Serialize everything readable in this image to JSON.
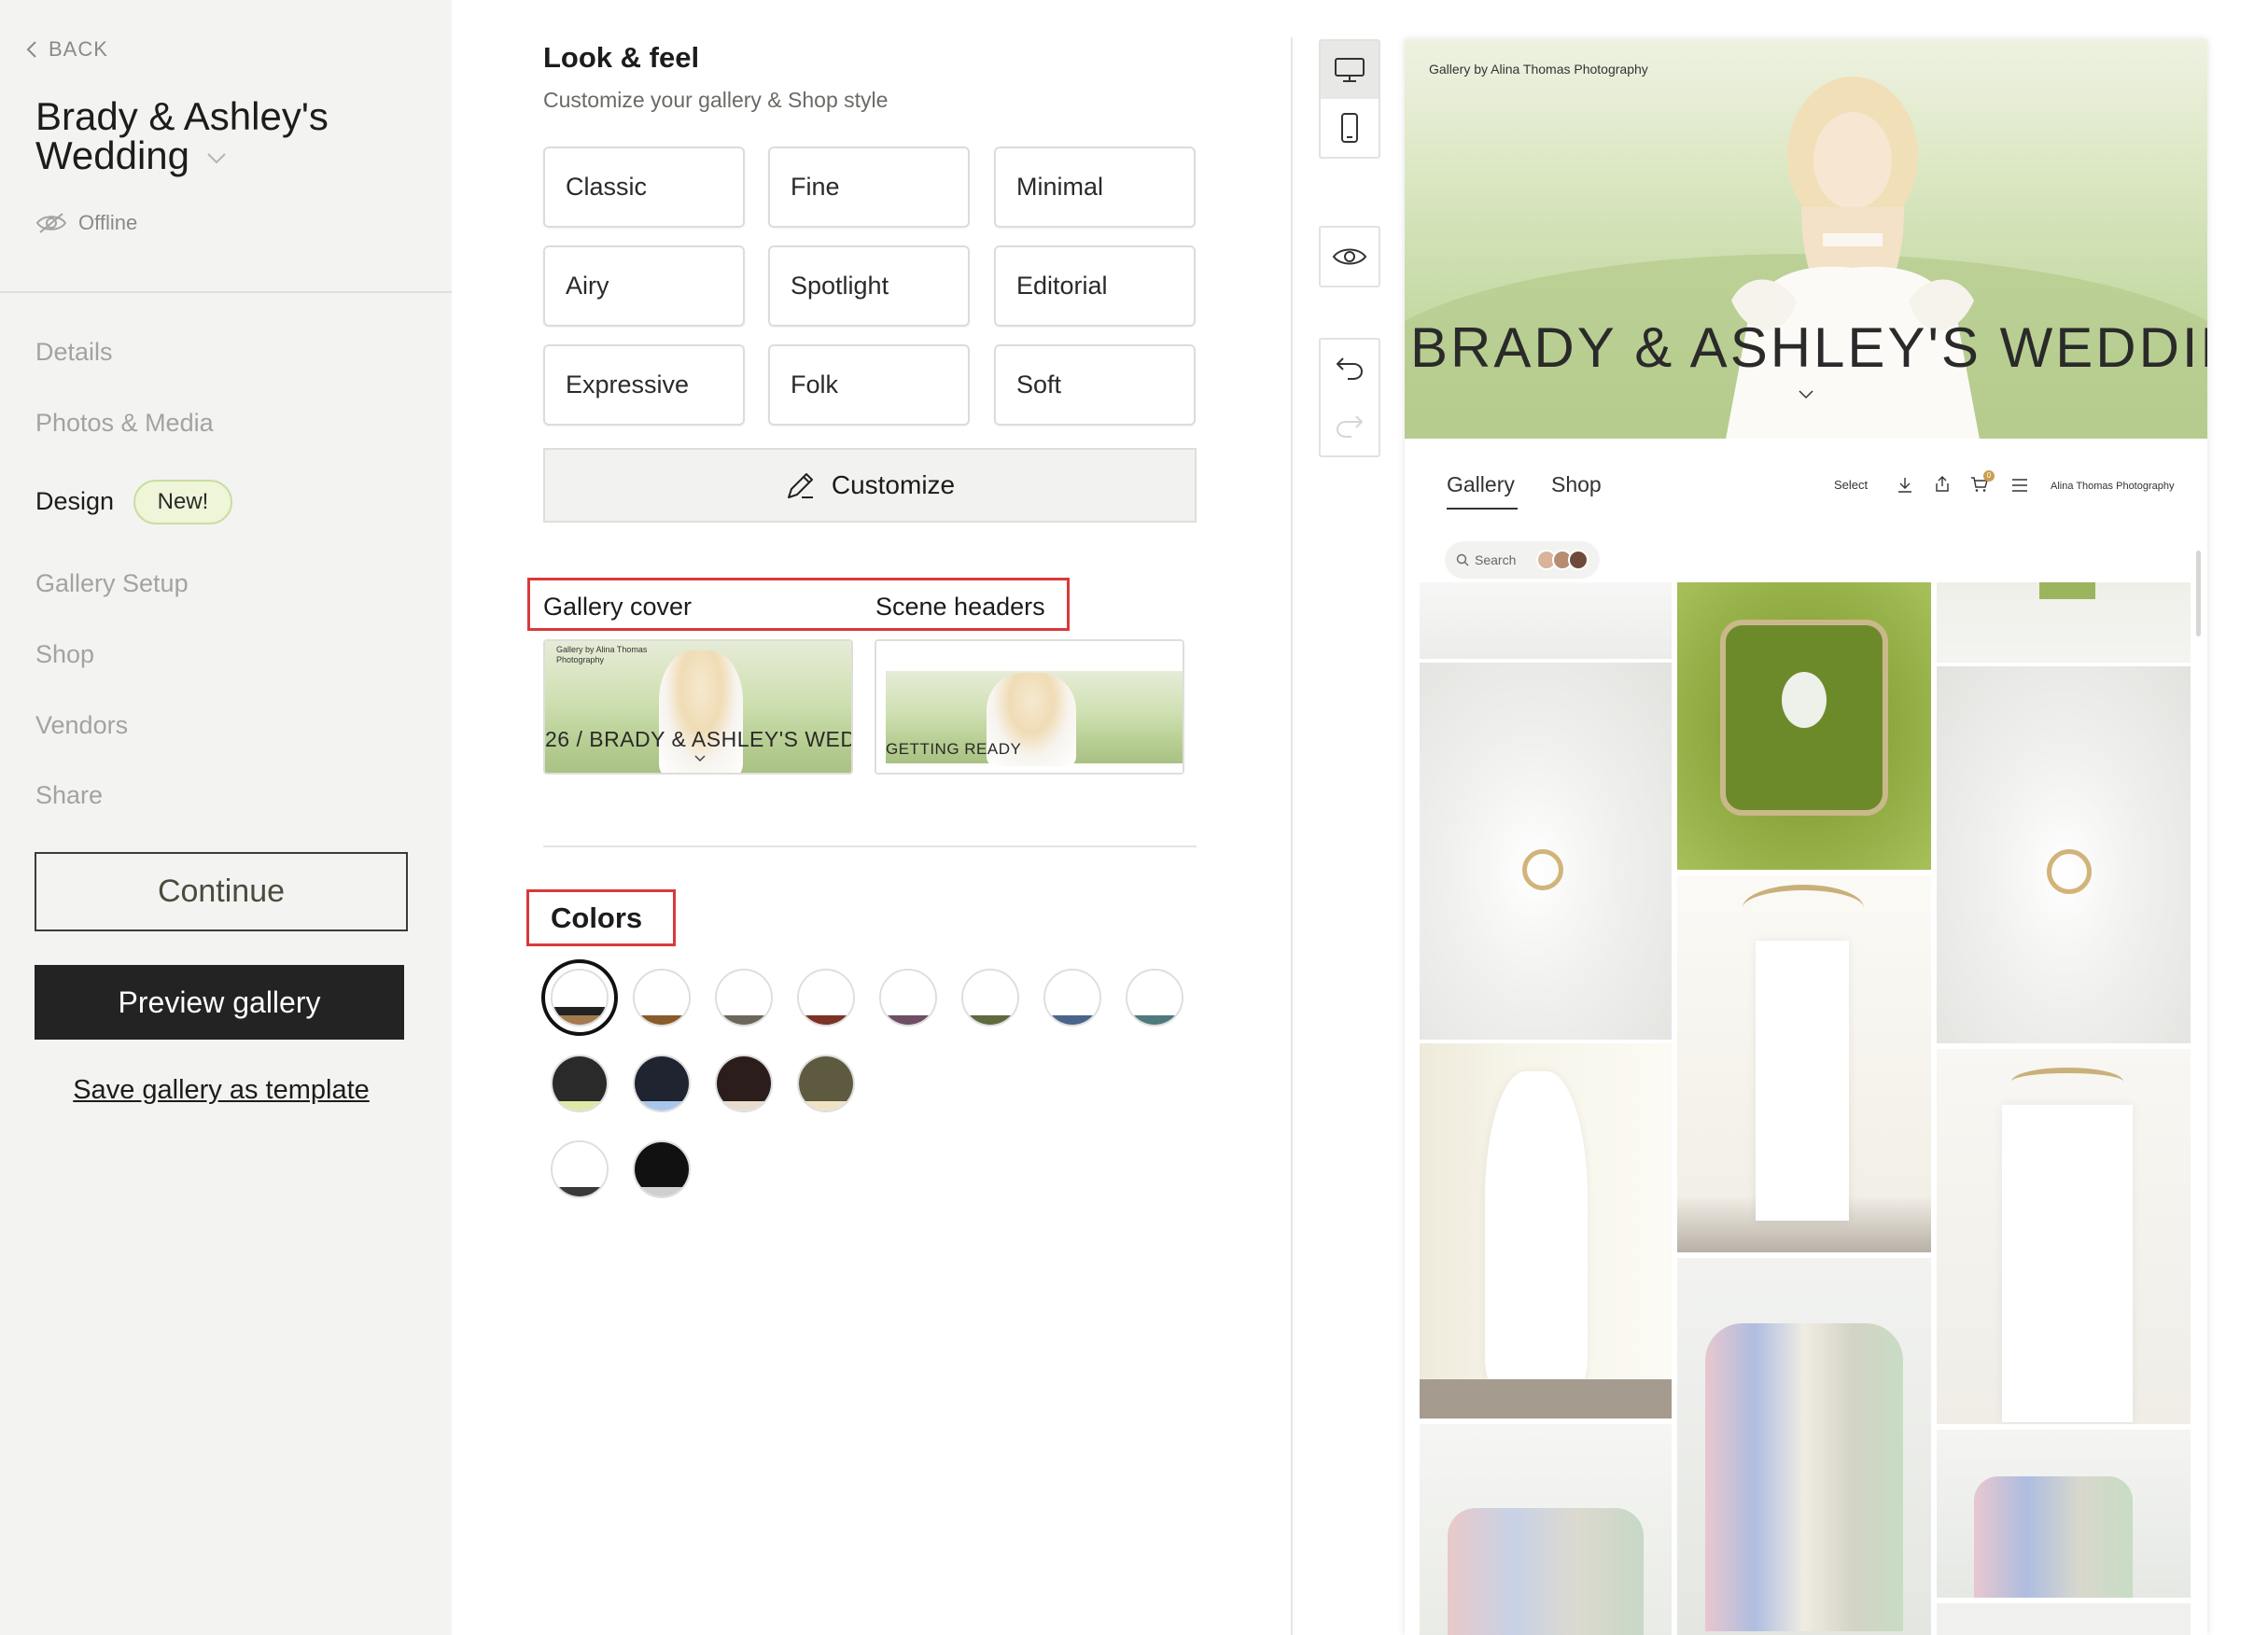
{
  "sidebar": {
    "back_label": "BACK",
    "gallery_title": "Brady & Ashley's Wedding",
    "status": "Offline",
    "nav": [
      {
        "label": "Details"
      },
      {
        "label": "Photos & Media"
      },
      {
        "label": "Design",
        "active": true,
        "badge": "New!"
      },
      {
        "label": "Gallery Setup"
      },
      {
        "label": "Shop"
      },
      {
        "label": "Vendors"
      },
      {
        "label": "Share"
      }
    ],
    "continue_label": "Continue",
    "preview_label": "Preview gallery",
    "template_link": "Save gallery as template"
  },
  "design": {
    "title": "Look & feel",
    "subtitle": "Customize your gallery & Shop style",
    "styles": [
      "Classic",
      "Fine",
      "Minimal",
      "Airy",
      "Spotlight",
      "Editorial",
      "Expressive",
      "Folk",
      "Soft"
    ],
    "customize_label": "Customize",
    "cover_tab": "Gallery cover",
    "scene_tab": "Scene headers",
    "cover_thumb": {
      "caption": "Gallery by Alina Thomas Photography",
      "title": "26 / BRADY & ASHLEY'S WED"
    },
    "scene_thumb": {
      "title": "GETTING READY"
    },
    "colors_title": "Colors",
    "swatches": [
      {
        "top": "#ffffff",
        "mid": "#222222",
        "bot": "#a37b4f",
        "selected": true
      },
      {
        "top": "#ffffff",
        "mid": "#ffffff",
        "bot": "#8a5a2a"
      },
      {
        "top": "#ffffff",
        "mid": "#ffffff",
        "bot": "#6c665d"
      },
      {
        "top": "#ffffff",
        "mid": "#ffffff",
        "bot": "#7a3326"
      },
      {
        "top": "#ffffff",
        "mid": "#ffffff",
        "bot": "#6e4f63"
      },
      {
        "top": "#ffffff",
        "mid": "#ffffff",
        "bot": "#5f6a3e"
      },
      {
        "top": "#ffffff",
        "mid": "#ffffff",
        "bot": "#4a648c"
      },
      {
        "top": "#ffffff",
        "mid": "#ffffff",
        "bot": "#4e7a7e"
      },
      {
        "top": "#2a2a2a",
        "mid": "#2a2a2a",
        "bot": "#ddeaa5"
      },
      {
        "top": "#1f2430",
        "mid": "#1f2430",
        "bot": "#a9c7ea"
      },
      {
        "top": "#2a1d1b",
        "mid": "#2a1d1b",
        "bot": "#e7ddcf"
      },
      {
        "top": "#5d5a3f",
        "mid": "#5d5a3f",
        "bot": "#f0e2c4"
      },
      {
        "top": "#ffffff",
        "mid": "#ffffff",
        "bot": "#3a3a3a"
      },
      {
        "top": "#111111",
        "mid": "#111111",
        "bot": "#cfcfcf"
      }
    ]
  },
  "toolbar": {
    "icons": [
      "desktop-icon",
      "mobile-icon",
      "eye-icon",
      "undo-icon",
      "redo-icon"
    ]
  },
  "preview": {
    "caption": "Gallery by Alina Thomas Photography",
    "title": "BRADY & ASHLEY'S WEDDING",
    "nav": [
      "Gallery",
      "Shop"
    ],
    "select_label": "Select",
    "cart_count": "0",
    "brand": "Alina Thomas Photography",
    "search_placeholder": "Search"
  }
}
